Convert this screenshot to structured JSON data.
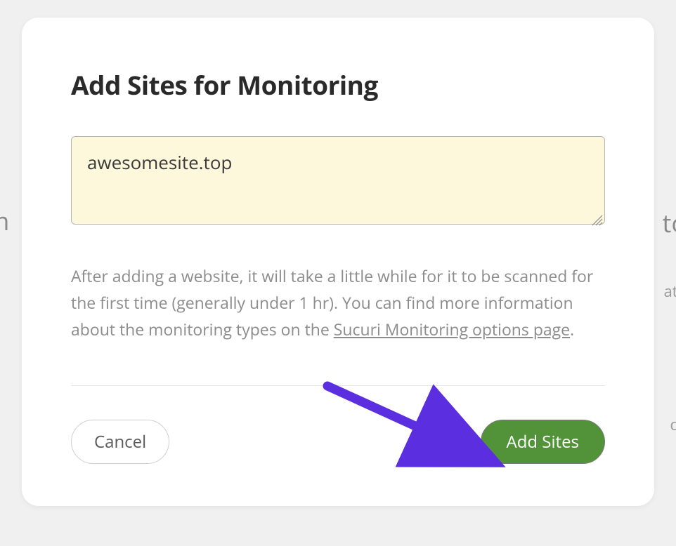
{
  "modal": {
    "title": "Add Sites for Monitoring",
    "textarea_value": "awesomesite.top",
    "description_prefix": "After adding a website, it will take a little while for it to be scanned for the first time (generally under 1 hr). You can find more information about the monitoring types on the ",
    "description_link": "Sucuri Monitoring options page",
    "description_suffix": ".",
    "cancel_label": "Cancel",
    "submit_label": "Add Sites"
  },
  "backdrop": {
    "left": "m",
    "right1": "to",
    "right2": "ate",
    "right3": "d"
  },
  "colors": {
    "primary": "#52933a",
    "arrow": "#5b2fe0",
    "textarea_bg": "#fdf8db"
  }
}
